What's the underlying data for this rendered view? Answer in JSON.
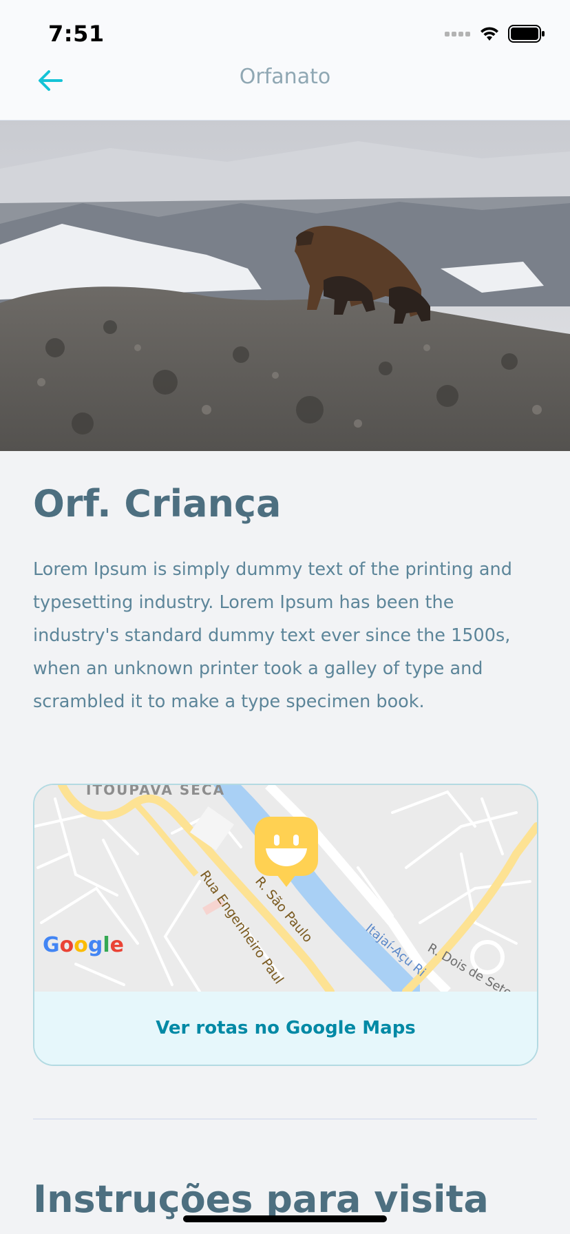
{
  "status_bar": {
    "time": "7:51"
  },
  "header": {
    "title": "Orfanato"
  },
  "orphanage": {
    "name": "Orf. Criança",
    "description": "Lorem Ipsum is simply dummy text of the printing and typesetting industry. Lorem Ipsum has been the industry's standard dummy text ever since the 1500s, when an unknown printer took a galley of type and scrambled it to make a type specimen book."
  },
  "map": {
    "labels": {
      "district": "ITOUPAVA SECA",
      "street1": "R. São Paulo",
      "street2": "Rua Engenheiro Paul",
      "river": "Itajaí-Açu Ri",
      "street3": "R. Dois de Setembro"
    },
    "google_logo": "Google",
    "route_link": "Ver rotas no Google Maps"
  },
  "instructions": {
    "title": "Instruções para visita"
  },
  "colors": {
    "accent": "#15c3d6",
    "title": "#4d6f80",
    "link": "#0089a5",
    "marker": "#ffd152"
  }
}
